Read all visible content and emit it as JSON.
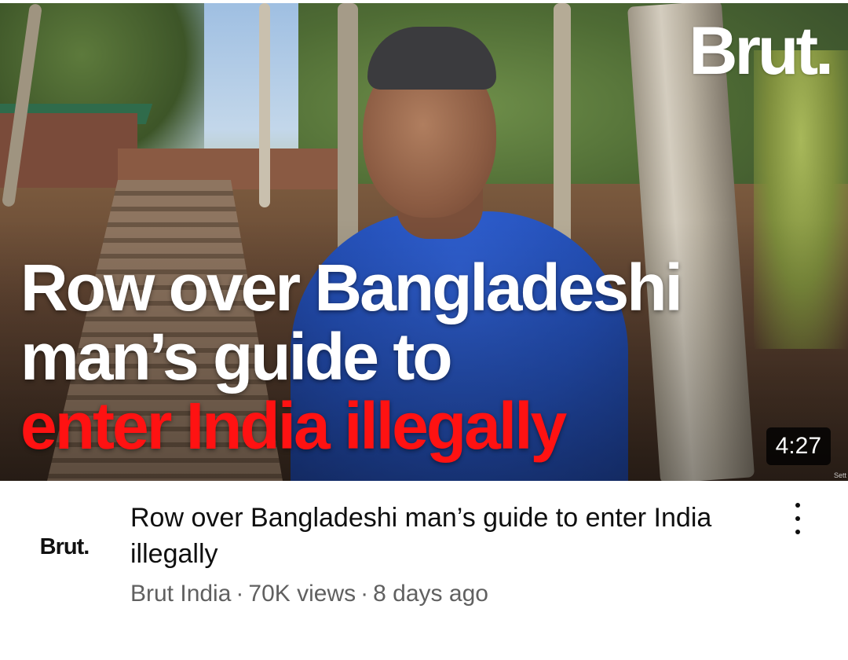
{
  "thumbnail": {
    "brand_logo": "Brut.",
    "headline_lines": [
      "Row over Bangladeshi",
      "man’s guide to"
    ],
    "headline_highlight": "enter India illegally",
    "duration": "4:27",
    "corner_text": "Sett",
    "highlight_color": "#ff1212"
  },
  "channel": {
    "avatar_text": "Brut.",
    "name": "Brut India"
  },
  "video": {
    "title": "Row over Bangladeshi man’s guide to enter India illegally",
    "views": "70K views",
    "age": "8 days ago",
    "separator": "·"
  },
  "menu": {
    "icon": "more-vert-icon"
  }
}
